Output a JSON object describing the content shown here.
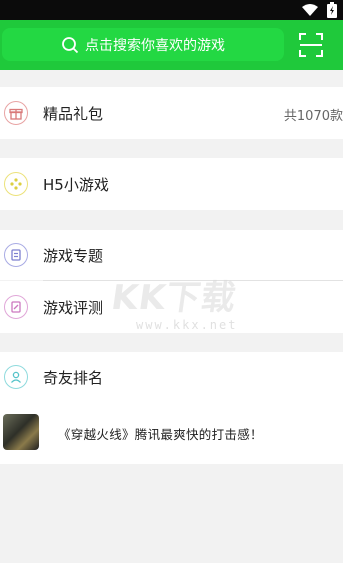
{
  "search": {
    "placeholder": "点击搜索你喜欢的游戏",
    "icon": "search-icon"
  },
  "menu": {
    "gift": {
      "label": "精品礼包",
      "trail": "共1070款"
    },
    "h5": {
      "label": "H5小游戏"
    },
    "topic": {
      "label": "游戏专题"
    },
    "review": {
      "label": "游戏评测"
    },
    "rank": {
      "label": "奇友排名"
    }
  },
  "featured": {
    "text": "《穿越火线》腾讯最爽快的打击感！"
  },
  "watermark": {
    "logo": "KK下载",
    "url": "www.kkx.net"
  },
  "colors": {
    "header_green": "#1fc93b",
    "gift_icon": "#e8a3a3",
    "h5_icon": "#e8dc5a",
    "topic_icon": "#8c8fd6",
    "review_icon": "#d98ccf",
    "rank_icon": "#6fd1d6"
  }
}
